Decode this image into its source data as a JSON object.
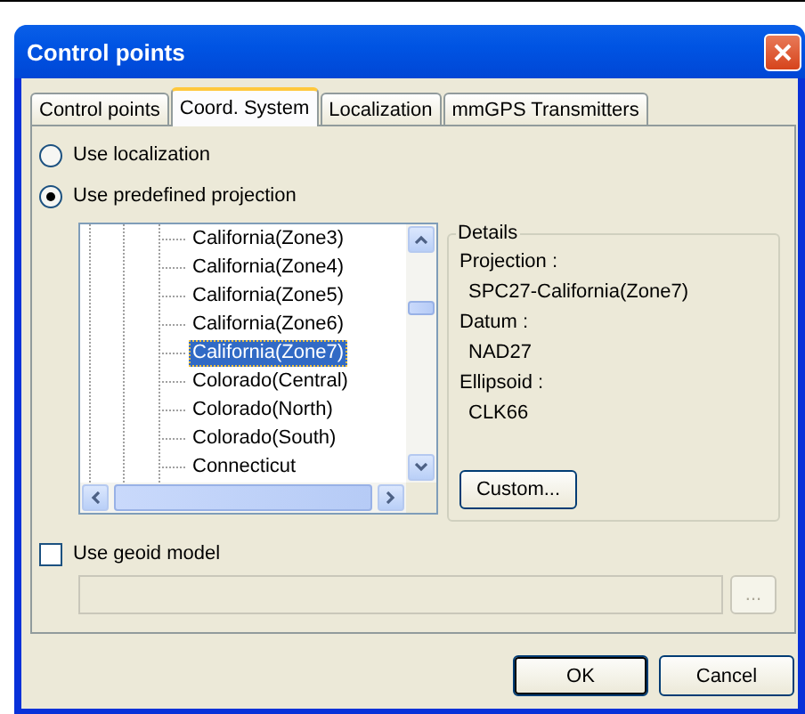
{
  "window": {
    "title": "Control points"
  },
  "tabs": [
    {
      "label": "Control points",
      "selected": false
    },
    {
      "label": "Coord. System",
      "selected": true
    },
    {
      "label": "Localization",
      "selected": false
    },
    {
      "label": "mmGPS Transmitters",
      "selected": false
    }
  ],
  "options": [
    {
      "label": "Use localization",
      "selected": false
    },
    {
      "label": "Use predefined projection",
      "selected": true
    }
  ],
  "projection_tree": {
    "items": [
      {
        "label": "California(Zone3)",
        "selected": false
      },
      {
        "label": "California(Zone4)",
        "selected": false
      },
      {
        "label": "California(Zone5)",
        "selected": false
      },
      {
        "label": "California(Zone6)",
        "selected": false
      },
      {
        "label": "California(Zone7)",
        "selected": true
      },
      {
        "label": "Colorado(Central)",
        "selected": false
      },
      {
        "label": "Colorado(North)",
        "selected": false
      },
      {
        "label": "Colorado(South)",
        "selected": false
      },
      {
        "label": "Connecticut",
        "selected": false
      }
    ]
  },
  "details": {
    "title": "Details",
    "fields": [
      {
        "label": "Projection :",
        "value": "SPC27-California(Zone7)"
      },
      {
        "label": "Datum :",
        "value": "NAD27"
      },
      {
        "label": "Ellipsoid :",
        "value": "CLK66"
      }
    ],
    "custom_button": "Custom..."
  },
  "geoid": {
    "label": "Use geoid model",
    "checked": false,
    "field_disabled": true,
    "browse_button": "...",
    "browse_disabled": true
  },
  "buttons": [
    {
      "label": "OK",
      "default": true
    },
    {
      "label": "Cancel",
      "default": false
    }
  ]
}
